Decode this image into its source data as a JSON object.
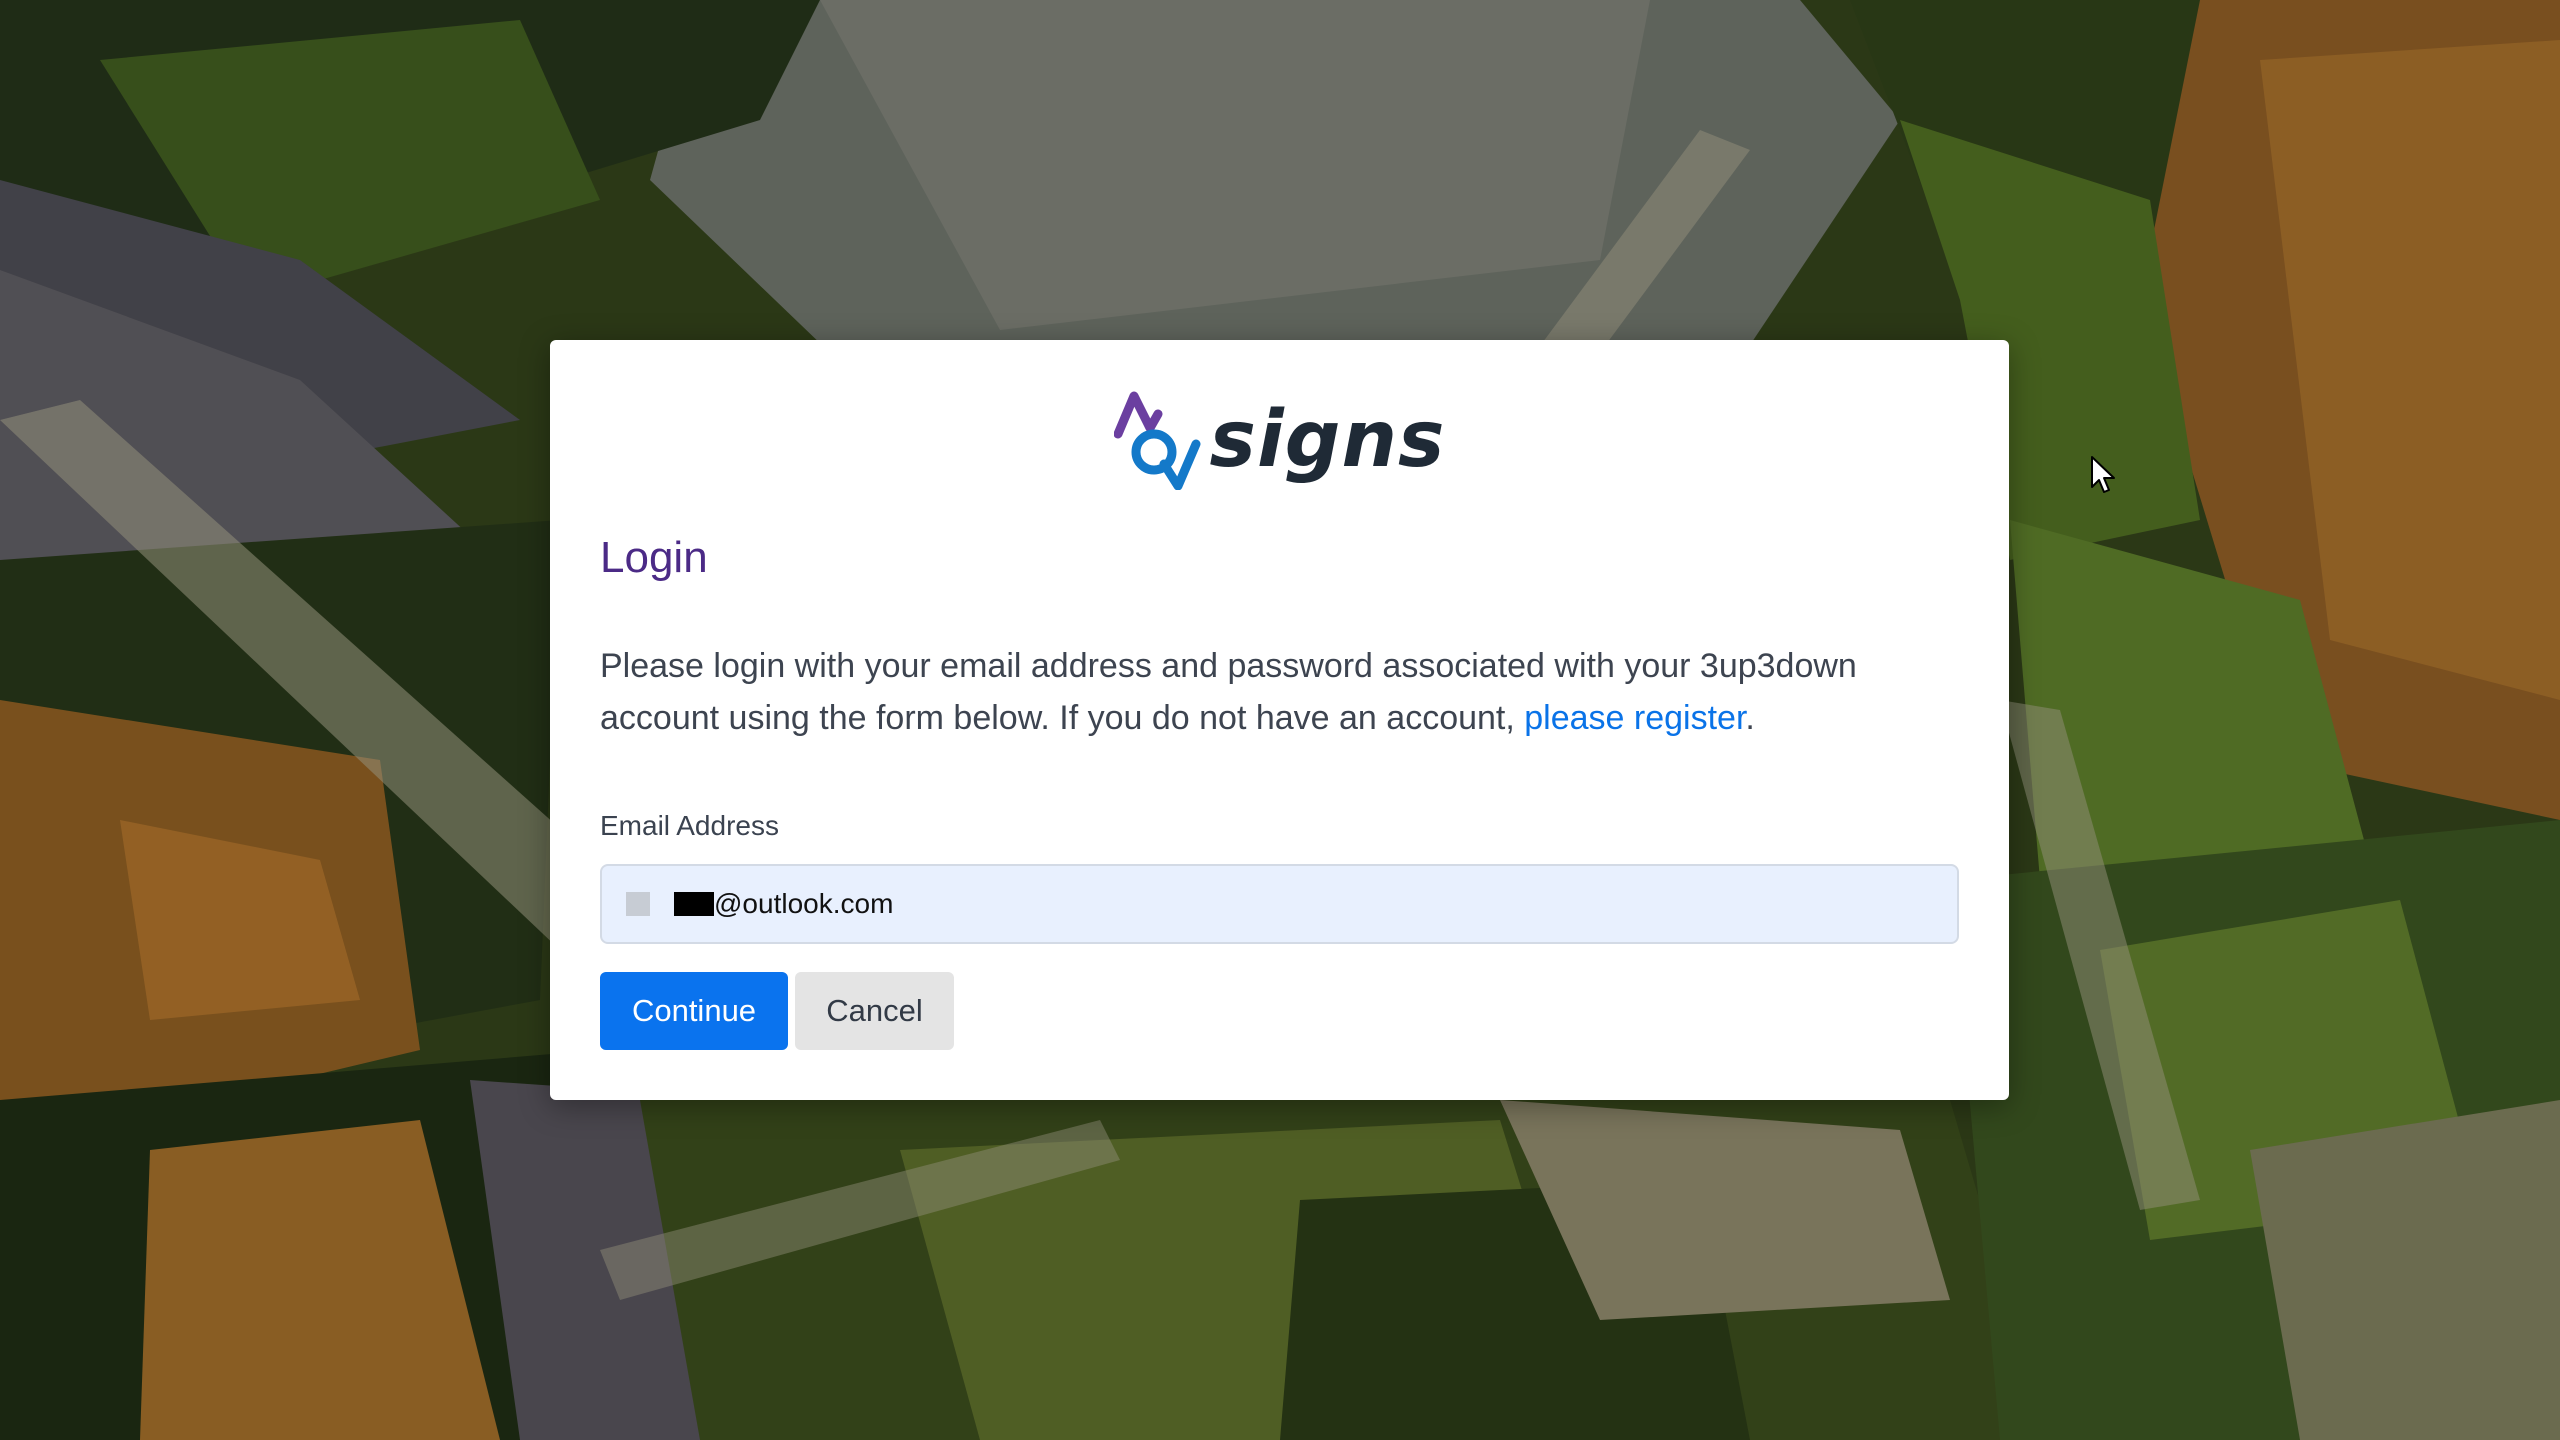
{
  "background": {
    "description_icon": "aerial-landscape-background"
  },
  "brand": {
    "wordmark": "signs",
    "logo_icon": "3up3down-arrows-logo",
    "colors": {
      "purple": "#6b3fa0",
      "blue": "#1479c9",
      "dark": "#1f2a36"
    }
  },
  "login": {
    "title": "Login",
    "intro_text": "Please login with your email address and password associated with your 3up3down account using the form below. If you do not have an account, ",
    "register_link": "please register",
    "intro_end": ".",
    "email_label": "Email Address",
    "email_value": "@outlook.com",
    "continue_label": "Continue",
    "cancel_label": "Cancel"
  },
  "colors": {
    "title": "#4b2a86",
    "link": "#0a73e8",
    "primary_button": "#0a73ee",
    "secondary_button": "#e4e4e4",
    "input_autofill": "#e8f0fe"
  }
}
